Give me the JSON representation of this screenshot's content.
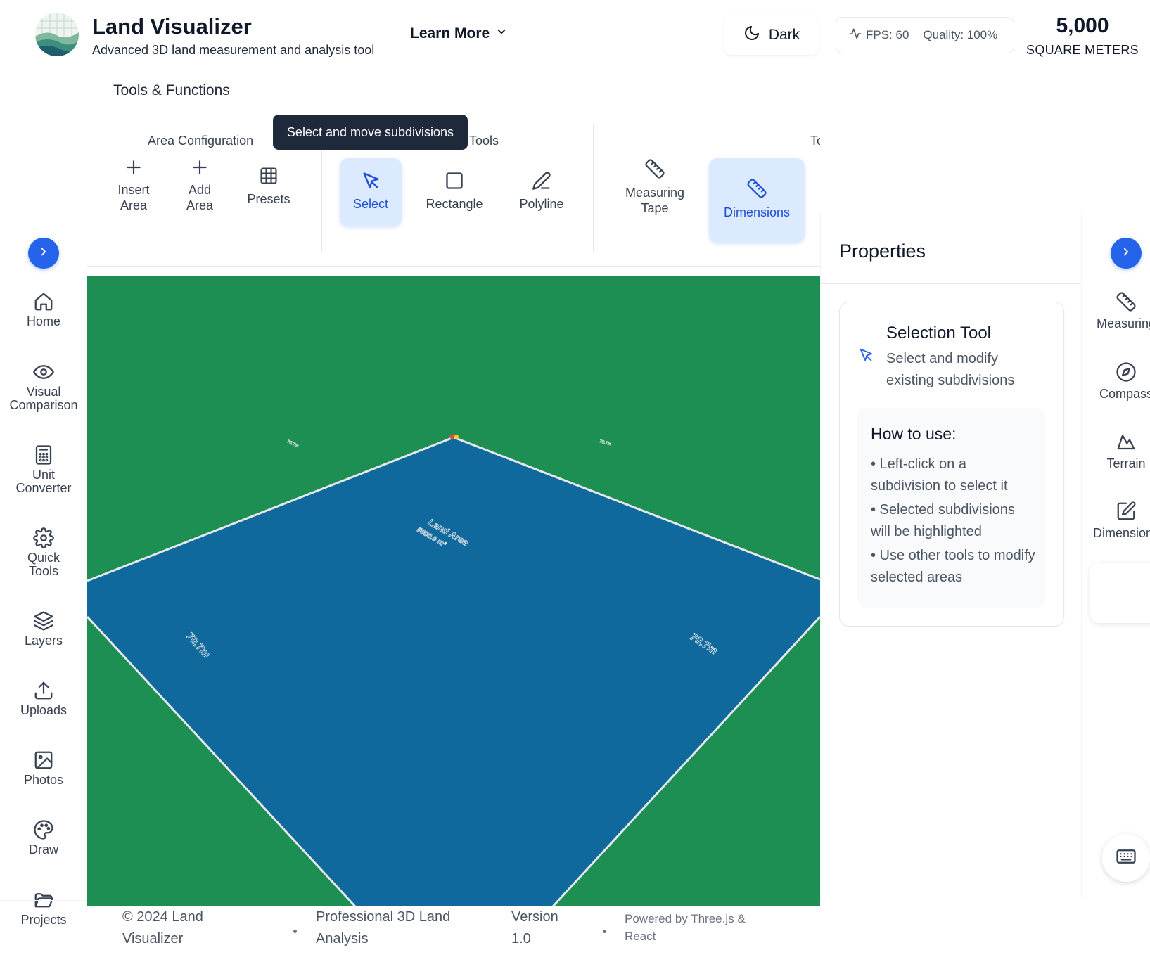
{
  "header": {
    "title": "Land Visualizer",
    "subtitle": "Advanced 3D land measurement and analysis tool",
    "learn_more": "Learn More",
    "theme_label": "Dark",
    "fps": "FPS: 60",
    "quality": "Quality: 100%",
    "area_value": "5,000",
    "area_unit": "SQUARE METERS"
  },
  "sidebar": {
    "items": [
      {
        "label_1": "Home",
        "label_2": "",
        "icon": "home-icon"
      },
      {
        "label_1": "Visual",
        "label_2": "Comparison",
        "icon": "eye-icon"
      },
      {
        "label_1": "Unit",
        "label_2": "Converter",
        "icon": "calculator-icon"
      },
      {
        "label_1": "Quick",
        "label_2": "Tools",
        "icon": "gear-icon"
      },
      {
        "label_1": "Layers",
        "label_2": "",
        "icon": "layers-icon"
      },
      {
        "label_1": "Uploads",
        "label_2": "",
        "icon": "upload-icon"
      },
      {
        "label_1": "Photos",
        "label_2": "",
        "icon": "image-icon"
      },
      {
        "label_1": "Draw",
        "label_2": "",
        "icon": "palette-icon"
      },
      {
        "label_1": "Projects",
        "label_2": "",
        "icon": "folder-icon"
      }
    ]
  },
  "tools": {
    "header": "Tools & Functions",
    "tooltip": "Select and move subdivisions",
    "groups": {
      "area_config": "Area Configuration",
      "drawing": "Tools",
      "third": "To"
    },
    "buttons": {
      "insert_area_1": "Insert",
      "insert_area_2": "Area",
      "add_area_1": "Add",
      "add_area_2": "Area",
      "presets": "Presets",
      "select": "Select",
      "rectangle": "Rectangle",
      "polyline": "Polyline",
      "measuring_tape_1": "Measuring",
      "measuring_tape_2": "Tape",
      "dimensions": "Dimensions"
    },
    "active_tool": "Select"
  },
  "canvas": {
    "colors": {
      "ground": "#1e8f52",
      "land": "#10699c",
      "edge": "#e5e7eb"
    },
    "area_label_1": "Land Area",
    "area_label_2": "5000.0 m²",
    "edge_left": "70.7m",
    "edge_right": "70.7m",
    "edge_far_left": "70.7m",
    "edge_far_right": "70.7m"
  },
  "properties": {
    "title": "Properties",
    "tool_title": "Selection Tool",
    "tool_desc": "Select and modify existing subdivisions",
    "howto_title": "How to use:",
    "howto": [
      "• Left-click on a subdivision to select it",
      "• Selected subdivisions will be highlighted",
      "• Use other tools to modify selected areas"
    ]
  },
  "right_rail": {
    "items": [
      {
        "label": "Measuring",
        "icon": "ruler-icon"
      },
      {
        "label": "Compass",
        "icon": "compass-icon"
      },
      {
        "label": "Terrain",
        "icon": "mountain-icon"
      },
      {
        "label": "Dimensions",
        "icon": "edit-icon"
      }
    ]
  },
  "footer": {
    "copyright_1": "© 2024 Land",
    "copyright_2": "Visualizer",
    "tagline_1": "Professional 3D Land",
    "tagline_2": "Analysis",
    "version_1": "Version",
    "version_2": "1.0",
    "powered_1": "Powered by Three.js &",
    "powered_2": "React"
  }
}
